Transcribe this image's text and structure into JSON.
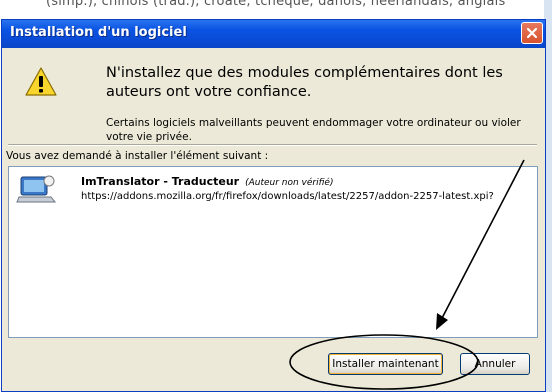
{
  "background": {
    "snippet_text": "(simp.), chinois (trad.), croate, tchèque, danois, néerlandais, anglais"
  },
  "dialog": {
    "title": "Installation d'un logiciel",
    "heading": "N'installez que des modules complémentaires dont les auteurs ont votre confiance.",
    "warning": "Certains logiciels malveillants peuvent endommager votre ordinateur ou violer votre vie privée.",
    "request_label": "Vous avez demandé à installer l'élément suivant :",
    "item": {
      "name": "ImTranslator - Traducteur",
      "author_note": "(Auteur non vérifié)",
      "url": "https://addons.mozilla.org/fr/firefox/downloads/latest/2257/addon-2257-latest.xpi?"
    },
    "buttons": {
      "install": "Installer maintenant",
      "cancel": "Annuler"
    }
  },
  "colors": {
    "titlebar": "#0a54e3",
    "dialog_bg": "#ece9d8",
    "annotation": "#000000"
  }
}
